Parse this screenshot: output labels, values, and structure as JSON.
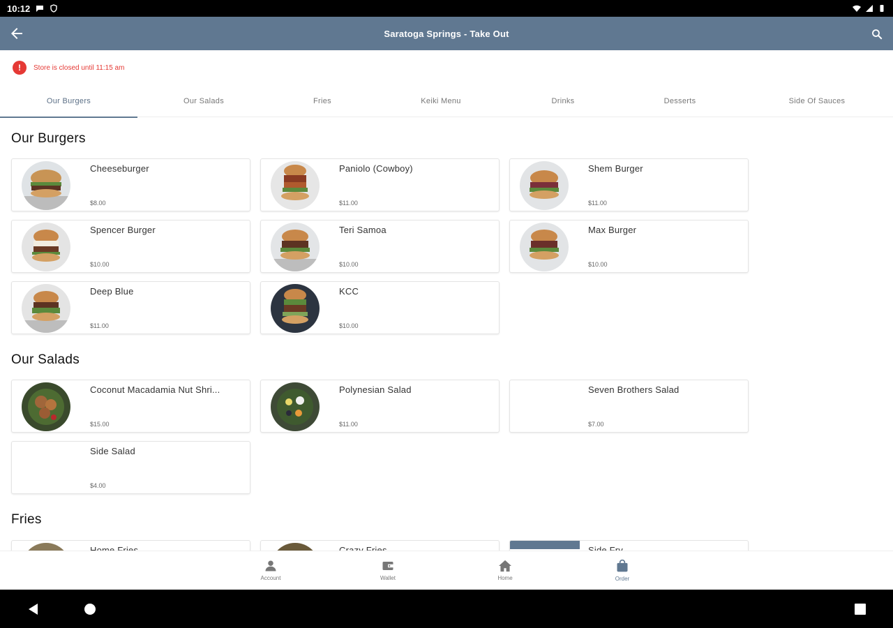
{
  "status_bar": {
    "time": "10:12"
  },
  "app_bar": {
    "title": "Saratoga Springs - Take Out"
  },
  "notice": {
    "icon": "!",
    "text": "Store is closed until 11:15 am"
  },
  "tabs": [
    {
      "label": "Our Burgers",
      "active": true
    },
    {
      "label": "Our Salads"
    },
    {
      "label": "Fries"
    },
    {
      "label": "Keiki Menu"
    },
    {
      "label": "Drinks"
    },
    {
      "label": "Desserts"
    },
    {
      "label": "Side Of Sauces"
    }
  ],
  "sections": {
    "burgers": {
      "title": "Our Burgers",
      "items": [
        {
          "name": "Cheeseburger",
          "price": "$8.00"
        },
        {
          "name": "Paniolo (Cowboy)",
          "price": "$11.00"
        },
        {
          "name": "Shem Burger",
          "price": "$11.00"
        },
        {
          "name": "Spencer Burger",
          "price": "$10.00"
        },
        {
          "name": "Teri Samoa",
          "price": "$10.00"
        },
        {
          "name": "Max Burger",
          "price": "$10.00"
        },
        {
          "name": "Deep Blue",
          "price": "$11.00"
        },
        {
          "name": "KCC",
          "price": "$10.00"
        }
      ]
    },
    "salads": {
      "title": "Our Salads",
      "items": [
        {
          "name": "Coconut Macadamia Nut Shri...",
          "price": "$15.00"
        },
        {
          "name": "Polynesian Salad",
          "price": "$11.00"
        },
        {
          "name": "Seven Brothers Salad",
          "price": "$7.00"
        },
        {
          "name": "Side Salad",
          "price": "$4.00"
        }
      ]
    },
    "fries": {
      "title": "Fries",
      "items": [
        {
          "name": "Home Fries"
        },
        {
          "name": "Crazy Fries"
        },
        {
          "name": "Side Fry"
        }
      ]
    }
  },
  "bottom_nav": [
    {
      "label": "Account",
      "icon": "person-icon"
    },
    {
      "label": "Wallet",
      "icon": "wallet-icon"
    },
    {
      "label": "Home",
      "icon": "home-icon"
    },
    {
      "label": "Order",
      "icon": "bag-icon",
      "active": true
    }
  ],
  "colors": {
    "primary": "#607891",
    "error": "#e53935"
  }
}
